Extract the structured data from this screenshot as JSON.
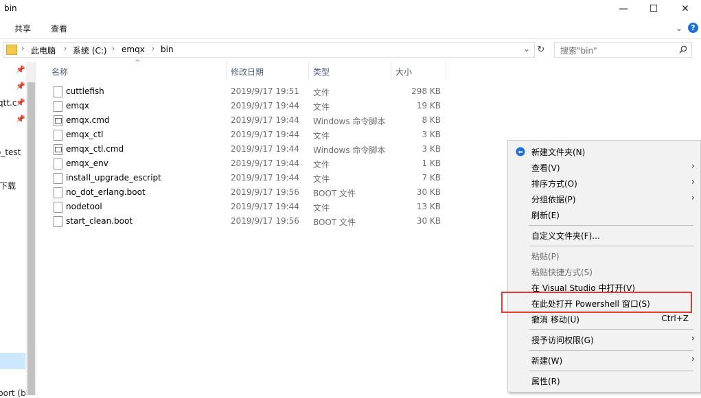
{
  "window": {
    "title": "bin",
    "minimize": "—",
    "maximize": "☐",
    "close": "✕"
  },
  "ribbon": {
    "tabs": [
      "共享",
      "查看"
    ],
    "expand": "⌄",
    "help": "?"
  },
  "address": {
    "crumbs": [
      "此电脑",
      "系统 (C:)",
      "emqx",
      "bin"
    ],
    "dropdown": "⌄",
    "refresh": "↻"
  },
  "search": {
    "placeholder": "搜索\"bin\"",
    "icon": "search-icon"
  },
  "nav": {
    "items": [
      "qtt.c",
      "o_test",
      "下载",
      "port (b"
    ]
  },
  "columns": {
    "name": "名称",
    "date": "修改日期",
    "type": "类型",
    "size": "大小",
    "sort_glyph": "^"
  },
  "files": [
    {
      "name": "cuttlefish",
      "date": "2019/9/17 19:51",
      "type": "文件",
      "size": "298 KB",
      "icon": "file"
    },
    {
      "name": "emqx",
      "date": "2019/9/17 19:44",
      "type": "文件",
      "size": "19 KB",
      "icon": "file"
    },
    {
      "name": "emqx.cmd",
      "date": "2019/9/17 19:44",
      "type": "Windows 命令脚本",
      "size": "8 KB",
      "icon": "cmd"
    },
    {
      "name": "emqx_ctl",
      "date": "2019/9/17 19:44",
      "type": "文件",
      "size": "3 KB",
      "icon": "file"
    },
    {
      "name": "emqx_ctl.cmd",
      "date": "2019/9/17 19:44",
      "type": "Windows 命令脚本",
      "size": "3 KB",
      "icon": "cmd"
    },
    {
      "name": "emqx_env",
      "date": "2019/9/17 19:44",
      "type": "文件",
      "size": "1 KB",
      "icon": "file"
    },
    {
      "name": "install_upgrade_escript",
      "date": "2019/9/17 19:44",
      "type": "文件",
      "size": "7 KB",
      "icon": "file"
    },
    {
      "name": "no_dot_erlang.boot",
      "date": "2019/9/17 19:56",
      "type": "BOOT 文件",
      "size": "30 KB",
      "icon": "file"
    },
    {
      "name": "nodetool",
      "date": "2019/9/17 19:44",
      "type": "文件",
      "size": "13 KB",
      "icon": "file"
    },
    {
      "name": "start_clean.boot",
      "date": "2019/9/17 19:56",
      "type": "BOOT 文件",
      "size": "30 KB",
      "icon": "file"
    }
  ],
  "context_menu": {
    "new_folder": "新建文件夹(N)",
    "view": "查看(V)",
    "sort": "排序方式(O)",
    "group": "分组依据(P)",
    "refresh": "刷新(E)",
    "customize": "自定义文件夹(F)...",
    "paste": "粘贴(P)",
    "paste_shortcut": "粘贴快捷方式(S)",
    "open_vs": "在 Visual Studio 中打开(V)",
    "open_powershell": "在此处打开 Powershell 窗口(S)",
    "undo_move": "撤消 移动(U)",
    "undo_shortcut": "Ctrl+Z",
    "grant_access": "授予访问权限(G)",
    "new": "新建(W)",
    "properties": "属性(R)",
    "submenu_arrow": "›",
    "highlight_color": "#e53935"
  }
}
